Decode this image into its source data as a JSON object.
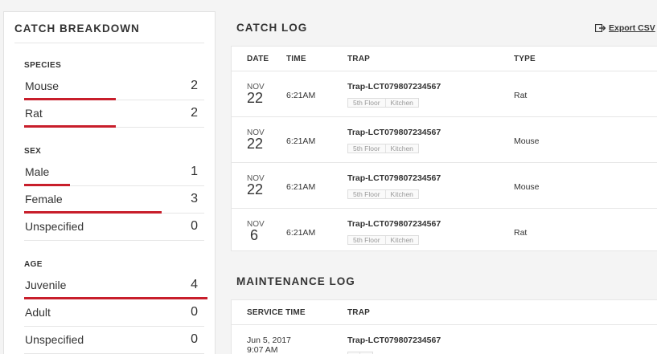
{
  "catch_breakdown": {
    "title": "CATCH BREAKDOWN",
    "accent_color": "#c81e2b",
    "groups": [
      {
        "label": "SPECIES",
        "rows": [
          {
            "label": "Mouse",
            "count": "2",
            "share": 0.5
          },
          {
            "label": "Rat",
            "count": "2",
            "share": 0.5
          }
        ]
      },
      {
        "label": "SEX",
        "rows": [
          {
            "label": "Male",
            "count": "1",
            "share": 0.25
          },
          {
            "label": "Female",
            "count": "3",
            "share": 0.75
          },
          {
            "label": "Unspecified",
            "count": "0",
            "share": 0
          }
        ]
      },
      {
        "label": "AGE",
        "rows": [
          {
            "label": "Juvenile",
            "count": "4",
            "share": 1.0
          },
          {
            "label": "Adult",
            "count": "0",
            "share": 0
          },
          {
            "label": "Unspecified",
            "count": "0",
            "share": 0
          }
        ]
      }
    ]
  },
  "catch_log": {
    "title": "CATCH LOG",
    "export_label": "Export CSV",
    "columns": {
      "date": "DATE",
      "time": "TIME",
      "trap": "TRAP",
      "type": "TYPE"
    },
    "rows": [
      {
        "month": "NOV",
        "day": "22",
        "time": "6:21AM",
        "trap": "Trap-LCT079807234567",
        "location": [
          "5th Floor",
          "Kitchen"
        ],
        "type": "Rat"
      },
      {
        "month": "NOV",
        "day": "22",
        "time": "6:21AM",
        "trap": "Trap-LCT079807234567",
        "location": [
          "5th Floor",
          "Kitchen"
        ],
        "type": "Mouse"
      },
      {
        "month": "NOV",
        "day": "22",
        "time": "6:21AM",
        "trap": "Trap-LCT079807234567",
        "location": [
          "5th Floor",
          "Kitchen"
        ],
        "type": "Mouse"
      },
      {
        "month": "NOV",
        "day": "6",
        "time": "6:21AM",
        "trap": "Trap-LCT079807234567",
        "location": [
          "5th Floor",
          "Kitchen"
        ],
        "type": "Rat"
      }
    ]
  },
  "maintenance_log": {
    "title": "MAINTENANCE LOG",
    "columns": {
      "service_time": "SERVICE TIME",
      "trap": "TRAP"
    },
    "rows": [
      {
        "date": "Jun 5, 2017",
        "time": "9:07 AM",
        "trap": "Trap-LCT079807234567"
      }
    ]
  }
}
